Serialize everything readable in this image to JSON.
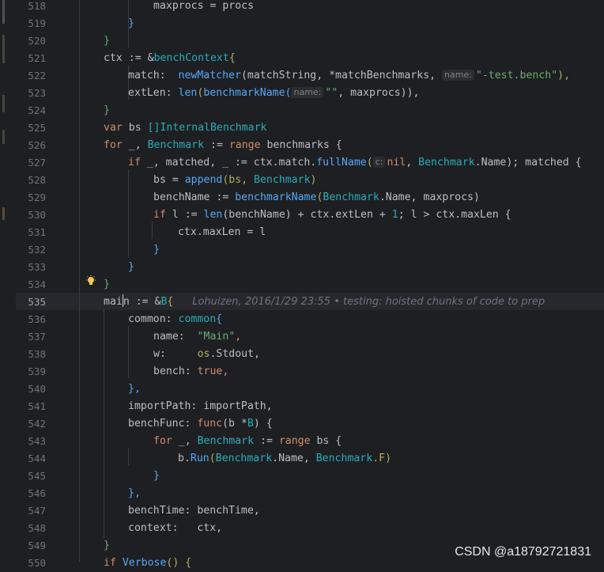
{
  "watermark": "CSDN @a18792721831",
  "blame_annotation": "Lohuizen, 2016/1/29 23:55 • testing: hoisted chunks of code to prep",
  "line_numbers": [
    "518",
    "519",
    "520",
    "521",
    "522",
    "523",
    "524",
    "525",
    "526",
    "527",
    "528",
    "529",
    "530",
    "531",
    "532",
    "533",
    "534",
    "535",
    "536",
    "537",
    "538",
    "539",
    "540",
    "541",
    "542",
    "543",
    "544",
    "545",
    "546",
    "547",
    "548",
    "549",
    "550"
  ],
  "hints": {
    "name1": "name:",
    "name2": "name:",
    "c": "c:"
  },
  "code": {
    "l518": "maxprocs = procs",
    "l519": "}",
    "l520": "}",
    "l521a": "ctx := &",
    "l521b": "benchContext",
    "l521c": "{",
    "l522a": "match:  ",
    "l522b": "newMatcher",
    "l522c": "(matchString, *matchBenchmarks, ",
    "l522d": "\"-test.bench\"",
    "l522e": "),",
    "l523a": "extLen: ",
    "l523b": "len",
    "l523c": "(",
    "l523d": "benchmarkName",
    "l523e": "(",
    "l523f": "\"\"",
    "l523g": ", maxprocs)),",
    "l524": "}",
    "l525a": "var",
    "l525b": " bs ",
    "l525c": "[]InternalBenchmark",
    "l526a": "for",
    "l526b": " _, ",
    "l526c": "Benchmark",
    "l526d": " := ",
    "l526e": "range",
    "l526f": " benchmarks {",
    "l527a": "if",
    "l527b": " _, matched, _ := ctx.match.",
    "l527c": "fullName",
    "l527d": "(",
    "l527e": "nil",
    "l527f": ", ",
    "l527g": "Benchmark",
    "l527h": ".Name); matched {",
    "l528a": "bs = ",
    "l528b": "append",
    "l528c": "(bs, ",
    "l528d": "Benchmark",
    "l528e": ")",
    "l529a": "benchName := ",
    "l529b": "benchmarkName",
    "l529c": "(",
    "l529d": "Benchmark",
    "l529e": ".Name, maxprocs)",
    "l530a": "if",
    "l530b": " l := ",
    "l530c": "len",
    "l530d": "(benchName) + ctx.extLen + ",
    "l530e": "1",
    "l530f": "; l > ctx.maxLen {",
    "l531": "ctx.maxLen = l",
    "l532": "}",
    "l533": "}",
    "l534": "}",
    "l535a": "mai",
    "l535b": "n := &",
    "l535c": "B",
    "l535d": "{",
    "l536a": "common: ",
    "l536b": "common",
    "l536c": "{",
    "l537a": "name:  ",
    "l537b": "\"Main\"",
    "l537c": ",",
    "l538a": "w:     ",
    "l538b": "os",
    "l538c": ".Stdout,",
    "l539a": "bench: ",
    "l539b": "true",
    "l539c": ",",
    "l540": "},",
    "l541": "importPath: importPath,",
    "l542a": "benchFunc: ",
    "l542b": "func",
    "l542c": "(b *",
    "l542d": "B",
    "l542e": ") {",
    "l543a": "for",
    "l543b": " _, ",
    "l543c": "Benchmark",
    "l543d": " := ",
    "l543e": "range",
    "l543f": " bs {",
    "l544a": "b.",
    "l544b": "Run",
    "l544c": "(",
    "l544d": "Benchmark",
    "l544e": ".Name, ",
    "l544f": "Benchmark",
    "l544g": ".F)",
    "l545": "}",
    "l546": "},",
    "l547": "benchTime: benchTime,",
    "l548": "context:   ctx,",
    "l549": "}",
    "l550a": "if",
    "l550b": " ",
    "l550c": "Verbose",
    "l550d": "() {"
  },
  "colors": {
    "background": "#1e1f22",
    "keyword": "#cf8e6d",
    "function": "#56a8f5",
    "type": "#2aacb8",
    "string": "#6aab73",
    "package": "#b3ae60"
  },
  "icons": {
    "bulb": "lightbulb-icon"
  }
}
